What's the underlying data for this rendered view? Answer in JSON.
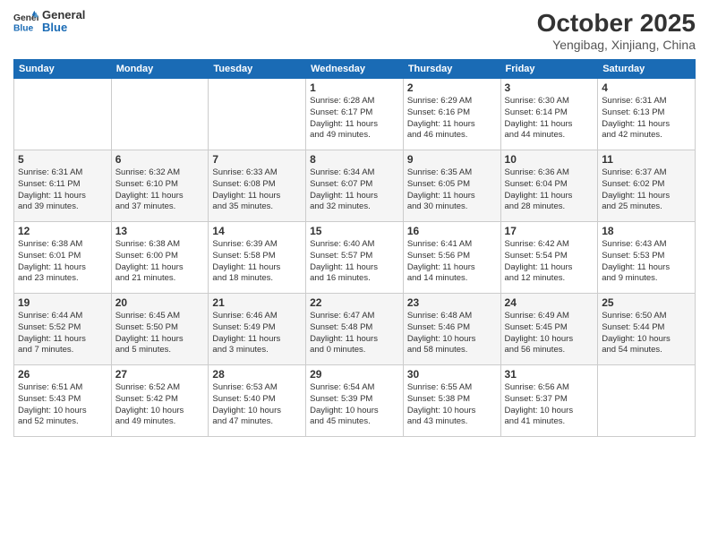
{
  "header": {
    "logo_line1": "General",
    "logo_line2": "Blue",
    "month": "October 2025",
    "location": "Yengibag, Xinjiang, China"
  },
  "weekdays": [
    "Sunday",
    "Monday",
    "Tuesday",
    "Wednesday",
    "Thursday",
    "Friday",
    "Saturday"
  ],
  "weeks": [
    [
      {
        "day": "",
        "info": ""
      },
      {
        "day": "",
        "info": ""
      },
      {
        "day": "",
        "info": ""
      },
      {
        "day": "1",
        "info": "Sunrise: 6:28 AM\nSunset: 6:17 PM\nDaylight: 11 hours\nand 49 minutes."
      },
      {
        "day": "2",
        "info": "Sunrise: 6:29 AM\nSunset: 6:16 PM\nDaylight: 11 hours\nand 46 minutes."
      },
      {
        "day": "3",
        "info": "Sunrise: 6:30 AM\nSunset: 6:14 PM\nDaylight: 11 hours\nand 44 minutes."
      },
      {
        "day": "4",
        "info": "Sunrise: 6:31 AM\nSunset: 6:13 PM\nDaylight: 11 hours\nand 42 minutes."
      }
    ],
    [
      {
        "day": "5",
        "info": "Sunrise: 6:31 AM\nSunset: 6:11 PM\nDaylight: 11 hours\nand 39 minutes."
      },
      {
        "day": "6",
        "info": "Sunrise: 6:32 AM\nSunset: 6:10 PM\nDaylight: 11 hours\nand 37 minutes."
      },
      {
        "day": "7",
        "info": "Sunrise: 6:33 AM\nSunset: 6:08 PM\nDaylight: 11 hours\nand 35 minutes."
      },
      {
        "day": "8",
        "info": "Sunrise: 6:34 AM\nSunset: 6:07 PM\nDaylight: 11 hours\nand 32 minutes."
      },
      {
        "day": "9",
        "info": "Sunrise: 6:35 AM\nSunset: 6:05 PM\nDaylight: 11 hours\nand 30 minutes."
      },
      {
        "day": "10",
        "info": "Sunrise: 6:36 AM\nSunset: 6:04 PM\nDaylight: 11 hours\nand 28 minutes."
      },
      {
        "day": "11",
        "info": "Sunrise: 6:37 AM\nSunset: 6:02 PM\nDaylight: 11 hours\nand 25 minutes."
      }
    ],
    [
      {
        "day": "12",
        "info": "Sunrise: 6:38 AM\nSunset: 6:01 PM\nDaylight: 11 hours\nand 23 minutes."
      },
      {
        "day": "13",
        "info": "Sunrise: 6:38 AM\nSunset: 6:00 PM\nDaylight: 11 hours\nand 21 minutes."
      },
      {
        "day": "14",
        "info": "Sunrise: 6:39 AM\nSunset: 5:58 PM\nDaylight: 11 hours\nand 18 minutes."
      },
      {
        "day": "15",
        "info": "Sunrise: 6:40 AM\nSunset: 5:57 PM\nDaylight: 11 hours\nand 16 minutes."
      },
      {
        "day": "16",
        "info": "Sunrise: 6:41 AM\nSunset: 5:56 PM\nDaylight: 11 hours\nand 14 minutes."
      },
      {
        "day": "17",
        "info": "Sunrise: 6:42 AM\nSunset: 5:54 PM\nDaylight: 11 hours\nand 12 minutes."
      },
      {
        "day": "18",
        "info": "Sunrise: 6:43 AM\nSunset: 5:53 PM\nDaylight: 11 hours\nand 9 minutes."
      }
    ],
    [
      {
        "day": "19",
        "info": "Sunrise: 6:44 AM\nSunset: 5:52 PM\nDaylight: 11 hours\nand 7 minutes."
      },
      {
        "day": "20",
        "info": "Sunrise: 6:45 AM\nSunset: 5:50 PM\nDaylight: 11 hours\nand 5 minutes."
      },
      {
        "day": "21",
        "info": "Sunrise: 6:46 AM\nSunset: 5:49 PM\nDaylight: 11 hours\nand 3 minutes."
      },
      {
        "day": "22",
        "info": "Sunrise: 6:47 AM\nSunset: 5:48 PM\nDaylight: 11 hours\nand 0 minutes."
      },
      {
        "day": "23",
        "info": "Sunrise: 6:48 AM\nSunset: 5:46 PM\nDaylight: 10 hours\nand 58 minutes."
      },
      {
        "day": "24",
        "info": "Sunrise: 6:49 AM\nSunset: 5:45 PM\nDaylight: 10 hours\nand 56 minutes."
      },
      {
        "day": "25",
        "info": "Sunrise: 6:50 AM\nSunset: 5:44 PM\nDaylight: 10 hours\nand 54 minutes."
      }
    ],
    [
      {
        "day": "26",
        "info": "Sunrise: 6:51 AM\nSunset: 5:43 PM\nDaylight: 10 hours\nand 52 minutes."
      },
      {
        "day": "27",
        "info": "Sunrise: 6:52 AM\nSunset: 5:42 PM\nDaylight: 10 hours\nand 49 minutes."
      },
      {
        "day": "28",
        "info": "Sunrise: 6:53 AM\nSunset: 5:40 PM\nDaylight: 10 hours\nand 47 minutes."
      },
      {
        "day": "29",
        "info": "Sunrise: 6:54 AM\nSunset: 5:39 PM\nDaylight: 10 hours\nand 45 minutes."
      },
      {
        "day": "30",
        "info": "Sunrise: 6:55 AM\nSunset: 5:38 PM\nDaylight: 10 hours\nand 43 minutes."
      },
      {
        "day": "31",
        "info": "Sunrise: 6:56 AM\nSunset: 5:37 PM\nDaylight: 10 hours\nand 41 minutes."
      },
      {
        "day": "",
        "info": ""
      }
    ]
  ]
}
